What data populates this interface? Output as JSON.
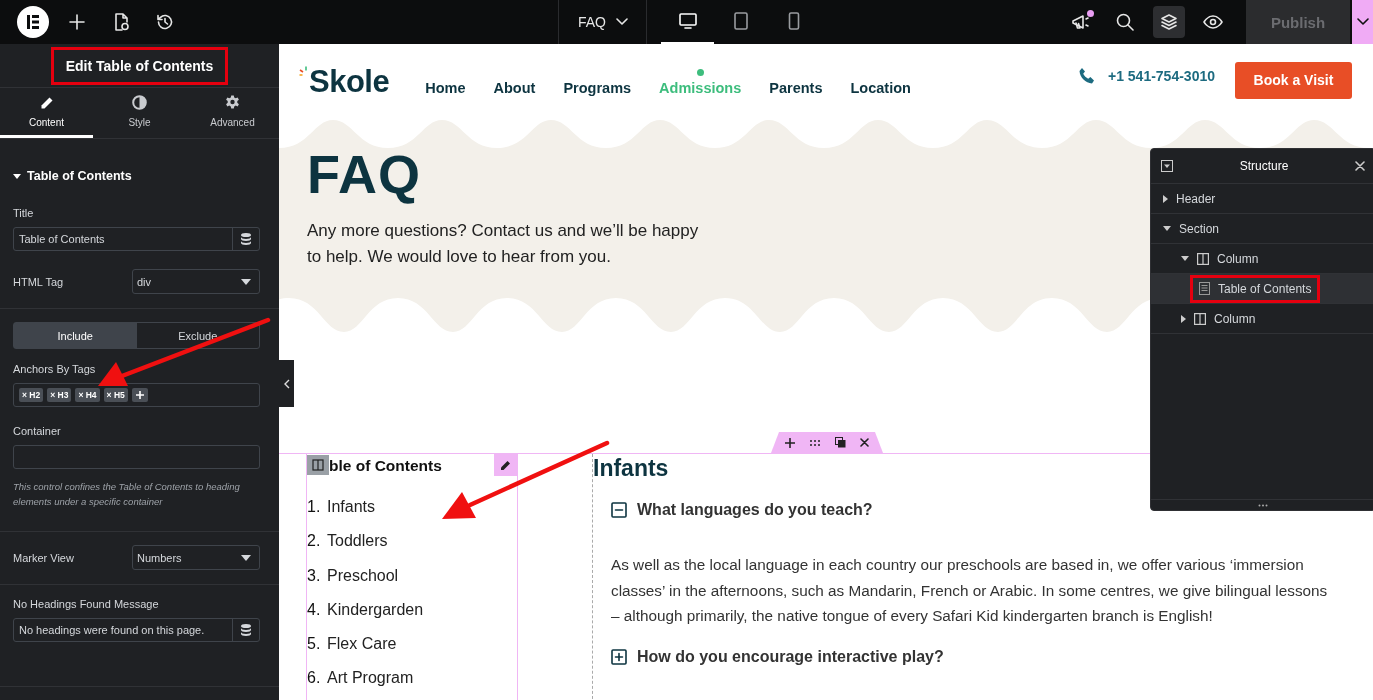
{
  "top_bar": {
    "tools": [
      {
        "kind": "logo"
      },
      {
        "kind": "add"
      },
      {
        "kind": "page"
      },
      {
        "kind": "history"
      }
    ],
    "page_menu": {
      "label": "FAQ"
    },
    "devices": [
      {
        "kind": "desktop",
        "selected": true
      },
      {
        "kind": "tablet",
        "selected": false
      },
      {
        "kind": "mobile",
        "selected": false
      }
    ],
    "actions": [
      {
        "kind": "announcements",
        "notification": true,
        "selected": false
      },
      {
        "kind": "search",
        "selected": false
      },
      {
        "kind": "structure",
        "selected": true
      },
      {
        "kind": "preview",
        "selected": false
      }
    ],
    "publish": {
      "label": "Publish",
      "disabled": true
    }
  },
  "panel": {
    "title": "Edit Table of Contents",
    "title_annotated": true,
    "tabs": [
      {
        "kind": "content",
        "label": "Content",
        "selected": true
      },
      {
        "kind": "style",
        "label": "Style",
        "selected": false
      },
      {
        "kind": "advanced",
        "label": "Advanced",
        "selected": false
      }
    ],
    "section": {
      "title": "Table of Contents",
      "expanded": true
    },
    "controls": [
      {
        "kind": "text",
        "label": "Title",
        "value": "Table of Contents"
      },
      {
        "kind": "select",
        "label": "HTML Tag",
        "value": "div"
      },
      {
        "kind": "divider"
      },
      {
        "kind": "switcher",
        "options": [
          {
            "label": "Include",
            "selected": true
          },
          {
            "label": "Exclude",
            "selected": false
          }
        ]
      },
      {
        "kind": "tags",
        "label": "Anchors By Tags",
        "tags": [
          "× H2",
          "× H3",
          "× H4",
          "× H5"
        ]
      },
      {
        "kind": "text",
        "label": "Container",
        "note": "This control confines the Table of Contents to heading elements under a specific container"
      },
      {
        "kind": "divider"
      },
      {
        "kind": "select",
        "label": "Marker View",
        "value": "Numbers"
      },
      {
        "kind": "divider"
      },
      {
        "kind": "text",
        "label": "No Headings Found Message",
        "value": "No headings were found on this page."
      }
    ]
  },
  "site_header": {
    "logo": "Skole",
    "nav": [
      {
        "label": "Home",
        "selected": false
      },
      {
        "label": "About",
        "selected": false
      },
      {
        "label": "Programs",
        "selected": false
      },
      {
        "label": "Admissions",
        "selected": true
      },
      {
        "label": "Parents",
        "selected": false
      },
      {
        "label": "Location",
        "selected": false
      }
    ],
    "phone": "+1 541-754-3010",
    "cta": "Book a Visit"
  },
  "hero": {
    "title": "FAQ",
    "text": "Any more questions? Contact us and we’ll be happy to help. We would love to hear from you."
  },
  "toc": {
    "title": "ble of Contents",
    "items": [
      {
        "marker": "1.",
        "label": "Infants"
      },
      {
        "marker": "2.",
        "label": "Toddlers"
      },
      {
        "marker": "3.",
        "label": "Preschool"
      },
      {
        "marker": "4.",
        "label": "Kindergarden"
      },
      {
        "marker": "5.",
        "label": "Flex Care"
      },
      {
        "marker": "6.",
        "label": "Art Program"
      }
    ]
  },
  "faq": {
    "heading": "Infants",
    "items": [
      {
        "question": "What languages do you teach?",
        "expanded": true,
        "answer": "As well as the local language in each country our preschools are based in, we offer various ‘immersion classes’ in the afternoons, such as Mandarin, French or Arabic. In some centres, we give bilingual lessons – although primarily, the native tongue of every Safari Kid kindergarten branch is English!"
      },
      {
        "question": "How do you encourage interactive play?",
        "expanded": false
      }
    ]
  },
  "structure": {
    "title": "Structure",
    "tree": [
      {
        "kind": "container",
        "label": "Header",
        "expanded": false,
        "selected": false,
        "annotated": false
      },
      {
        "kind": "container",
        "label": "Section",
        "expanded": true,
        "selected": false,
        "annotated": false,
        "children": [
          {
            "kind": "column",
            "label": "Column",
            "expanded": true,
            "selected": false,
            "annotated": false,
            "children": [
              {
                "kind": "widget",
                "label": "Table of Contents",
                "selected": true,
                "annotated": true
              }
            ]
          },
          {
            "kind": "column",
            "label": "Column",
            "expanded": false,
            "selected": false,
            "annotated": false
          }
        ]
      }
    ]
  }
}
